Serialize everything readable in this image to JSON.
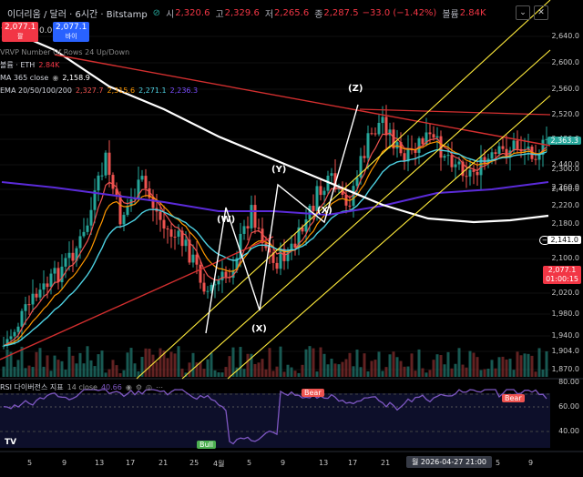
{
  "header": {
    "symbol": "이더리움 / 달러 · 6시간 · Bitstamp",
    "ohlc": [
      {
        "k": "시",
        "v": "2,320.6"
      },
      {
        "k": "고",
        "v": "2,329.6"
      },
      {
        "k": "저",
        "v": "2,265.6"
      },
      {
        "k": "종",
        "v": "2,287.5"
      }
    ],
    "change": "−33.0 (−1.42%)",
    "volume_label": "볼륨",
    "volume": "2.84K",
    "sell_price": "2,077.1",
    "sell_label": "팔",
    "spread": "0.0",
    "buy_price": "2,077.1",
    "buy_label": "바이"
  },
  "indicators": [
    {
      "label": "VRVP Number Of Rows 24 Up/Down",
      "value": ""
    },
    {
      "label": "볼륨 · ETH",
      "value": "2.84K"
    },
    {
      "label": "MA 365 close",
      "value": "2,158.9"
    },
    {
      "label": "EMA 20/50/100/200",
      "values": [
        "2,327.7",
        "2,315.6",
        "2,271.1",
        "2,236.3"
      ]
    }
  ],
  "y_axis": [
    "2,640.0",
    "2,600.0",
    "2,560.0",
    "2,520.0",
    "2,480.0",
    "2,440.0",
    "2,400.0",
    "2,363.3",
    "2,300.0",
    "2,260.0",
    "2,220.0",
    "2,180.0",
    "2,141.0",
    "2,100.0",
    "2,077.1",
    "2,020.0",
    "1,980.0",
    "1,940.0",
    "1,904.0",
    "1,870.0"
  ],
  "price_tags": {
    "current": "2,363.3",
    "ma": "2,141.0",
    "last": "2,077.1",
    "countdown": "01:00:15"
  },
  "x_axis": [
    "5",
    "9",
    "13",
    "17",
    "21",
    "25",
    "4월",
    "5",
    "9",
    "13",
    "17",
    "21",
    "5",
    "9"
  ],
  "crosshair_label": "월 2026-04-27 21:00",
  "waves": [
    "(W)",
    "(X)",
    "(Y)",
    "(X)",
    "(Z)"
  ],
  "rsi": {
    "label": "RSI 다이버전스 지표",
    "length": "14 close",
    "value": "40.66",
    "y_axis": [
      "80.00",
      "60.00",
      "40.00"
    ],
    "tags": [
      "Bear",
      "Bull",
      "Bear"
    ]
  },
  "colors": {
    "bg": "#000000",
    "up": "#26a69a",
    "down": "#ef5350",
    "ma365": "#ffffff",
    "ema20": "#ef5350",
    "ema50": "#ff9800",
    "ema100": "#4dd0e1",
    "ema200": "#5b2bd9",
    "trend": "#d32f2f",
    "channel": "#ffeb3b",
    "rsi": "#7e57c2"
  }
}
